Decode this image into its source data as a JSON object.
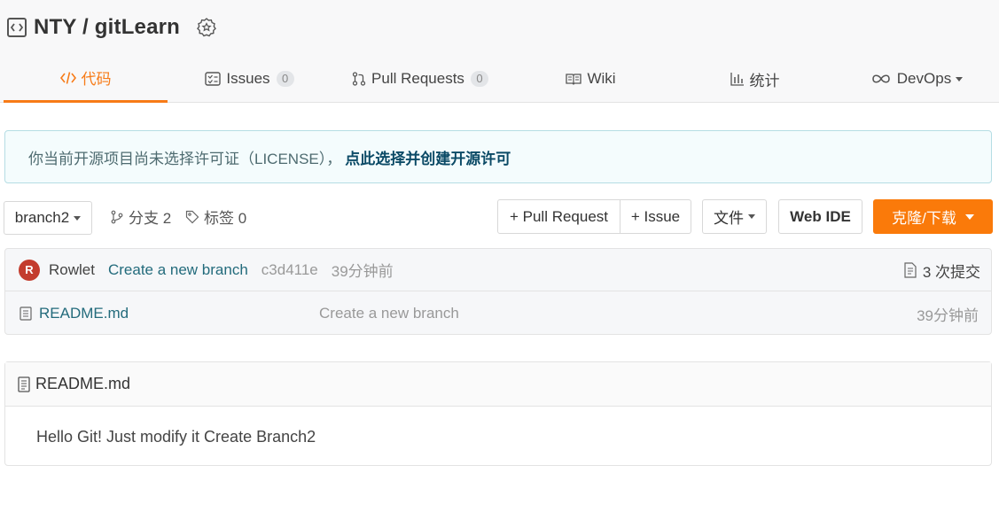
{
  "repo": {
    "title": "NTY / gitLearn",
    "icon": "repo-code-icon",
    "badge_icon": "award-badge-icon"
  },
  "tabs": [
    {
      "label": "代码",
      "icon": "code-icon",
      "active": true
    },
    {
      "label": "Issues",
      "icon": "issues-icon",
      "count": "0"
    },
    {
      "label": "Pull Requests",
      "icon": "pull-request-icon",
      "count": "0"
    },
    {
      "label": "Wiki",
      "icon": "wiki-book-icon"
    },
    {
      "label": "统计",
      "icon": "bar-chart-icon"
    },
    {
      "label": "DevOps",
      "icon": "infinity-icon"
    }
  ],
  "notice": {
    "text": "你当前开源项目尚未选择许可证（LICENSE），",
    "link": "点此选择并创建开源许可"
  },
  "toolbar": {
    "branch": "branch2",
    "branches_label": "分支 2",
    "tags_label": "标签 0",
    "pull_request_btn": "+ Pull Request",
    "issue_btn": "+ Issue",
    "file_btn": "文件",
    "webide_btn": "Web IDE",
    "clone_btn": "克隆/下载"
  },
  "commit": {
    "avatar_letter": "R",
    "author": "Rowlet",
    "message": "Create a new branch",
    "sha": "c3d411e",
    "time": "39分钟前",
    "commits_count": "3 次提交"
  },
  "files": [
    {
      "name": "README.md",
      "message": "Create a new branch",
      "time": "39分钟前"
    }
  ],
  "readme": {
    "title": "README.md",
    "content": "Hello Git! Just modify it Create Branch2"
  },
  "colors": {
    "accent": "#f77b17",
    "clone_button": "#fa7a0a",
    "link": "#236b7c",
    "avatar": "#c33c2e"
  }
}
